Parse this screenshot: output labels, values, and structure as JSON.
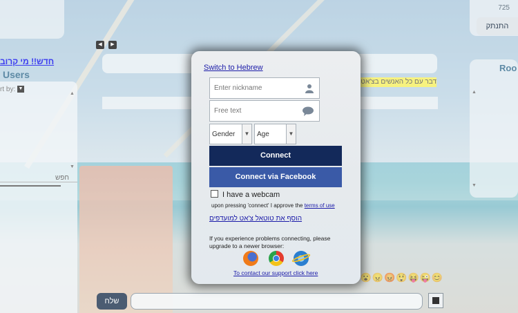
{
  "header": {
    "online_count": "725",
    "disconnect_label": "התנתק"
  },
  "left": {
    "new_link": "חדש!! מי קרוב",
    "users_title": "Users",
    "sort_label": "rt by:",
    "search_label": "חפש"
  },
  "right": {
    "rooms_title": "Roo"
  },
  "chat": {
    "top_line": "דבר עם כל האנשים בצ'אט דרך",
    "send_label": "שלח"
  },
  "dialog": {
    "switch_lang": "Switch to Hebrew",
    "nickname_placeholder": "Enter nickname",
    "freetext_placeholder": "Free text",
    "gender_label": "Gender",
    "age_label": "Age",
    "connect_label": "Connect",
    "facebook_label": "Connect via Facebook",
    "webcam_label": "I have a webcam",
    "terms_text": "upon pressing 'connect' I approve the ",
    "terms_link": "terms of use",
    "favorites_link": "הוסף את טוטאל צ'אט למועדפים",
    "problem_text": "If you experience problems connecting, please upgrade to a newer browser:",
    "support_link": "To contact our support click here",
    "browsers": [
      "firefox-icon",
      "chrome-icon",
      "internet-explorer-icon"
    ]
  },
  "emojis": "😊😐😑😶😮😠😡😲😝😜😊",
  "colors": {
    "connect_bg": "#13295a",
    "facebook_bg": "#3a5aa7",
    "link": "#1a1aa8",
    "highlight": "#f7f27f"
  }
}
